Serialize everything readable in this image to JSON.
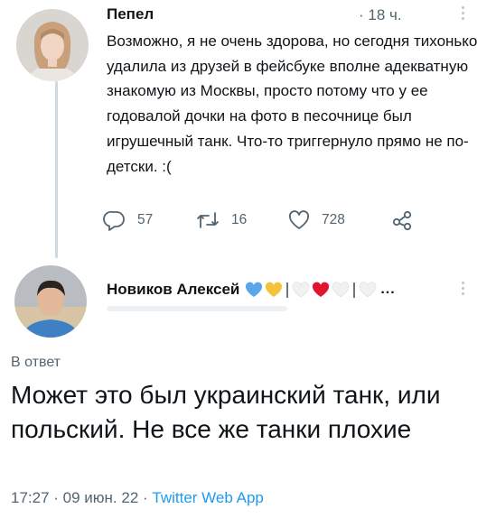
{
  "tweet": {
    "author": "Пепел",
    "time": "· 18 ч.",
    "text": "Возможно, я не очень здорова, но сегодня тихонько удалила из друзей в фейсбуке вполне адекватную знакомую из Москвы, просто потому что у ее годовалой дочки на фото в песочнице был игрушечный танк. Что-то триггернуло прямо не по-детски. :(",
    "stats": {
      "replies": "57",
      "retweets": "16",
      "likes": "728"
    }
  },
  "reply": {
    "author": "Новиков Алексей",
    "author_suffix": "...",
    "in_reply_label": "В ответ",
    "text": "Может это был украинский танк, или польский. Не все же танки плохие",
    "timestamp": "17:27 · 09 июн. 22 · ",
    "source_app": "Twitter Web App"
  },
  "colors": {
    "text": "#0f1419",
    "muted": "#536471",
    "link": "#1d9bf0",
    "heart_blue": "#5aa6ea",
    "heart_yellow": "#f5c33b",
    "heart_white": "#f1f1f1",
    "heart_red": "#e0152e"
  },
  "icons": [
    "reply-icon",
    "retweet-icon",
    "like-icon",
    "share-icon",
    "more-icon"
  ]
}
